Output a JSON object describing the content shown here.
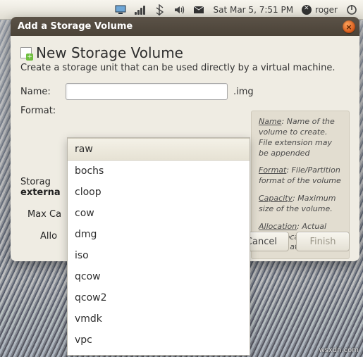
{
  "menubar": {
    "datetime": "Sat Mar  5,  7:51 PM",
    "username": "roger"
  },
  "dialog": {
    "title": "Add a Storage Volume",
    "heading": "New Storage Volume",
    "subheading": "Create a storage unit that can be used directly by a virtual machine.",
    "name_label": "Name:",
    "name_value": "",
    "name_suffix": ".img",
    "format_label": "Format:",
    "format_selected": "raw",
    "format_options": [
      "raw",
      "bochs",
      "cloop",
      "cow",
      "dmg",
      "iso",
      "qcow",
      "qcow2",
      "vmdk",
      "vpc"
    ],
    "section_heading_visible_part": "Storag",
    "section_sub_visible_part": "externa",
    "maxcap_label_visible_part": "Max Ca",
    "alloc_label_visible_part": "Allo",
    "buttons": {
      "cancel": "Cancel",
      "finish": "Finish"
    }
  },
  "help": {
    "name_key": "Name",
    "name_text": ": Name of the volume to create. File extension may be appended",
    "format_key": "Format",
    "format_text": ": File/Partition format of the volume",
    "capacity_key": "Capacity",
    "capacity_text": ": Maximum size of the volume.",
    "allocation_key": "Allocation",
    "allocation_text": ": Actual size allocated to volume at this time."
  },
  "watermark": "wsxdn.com"
}
